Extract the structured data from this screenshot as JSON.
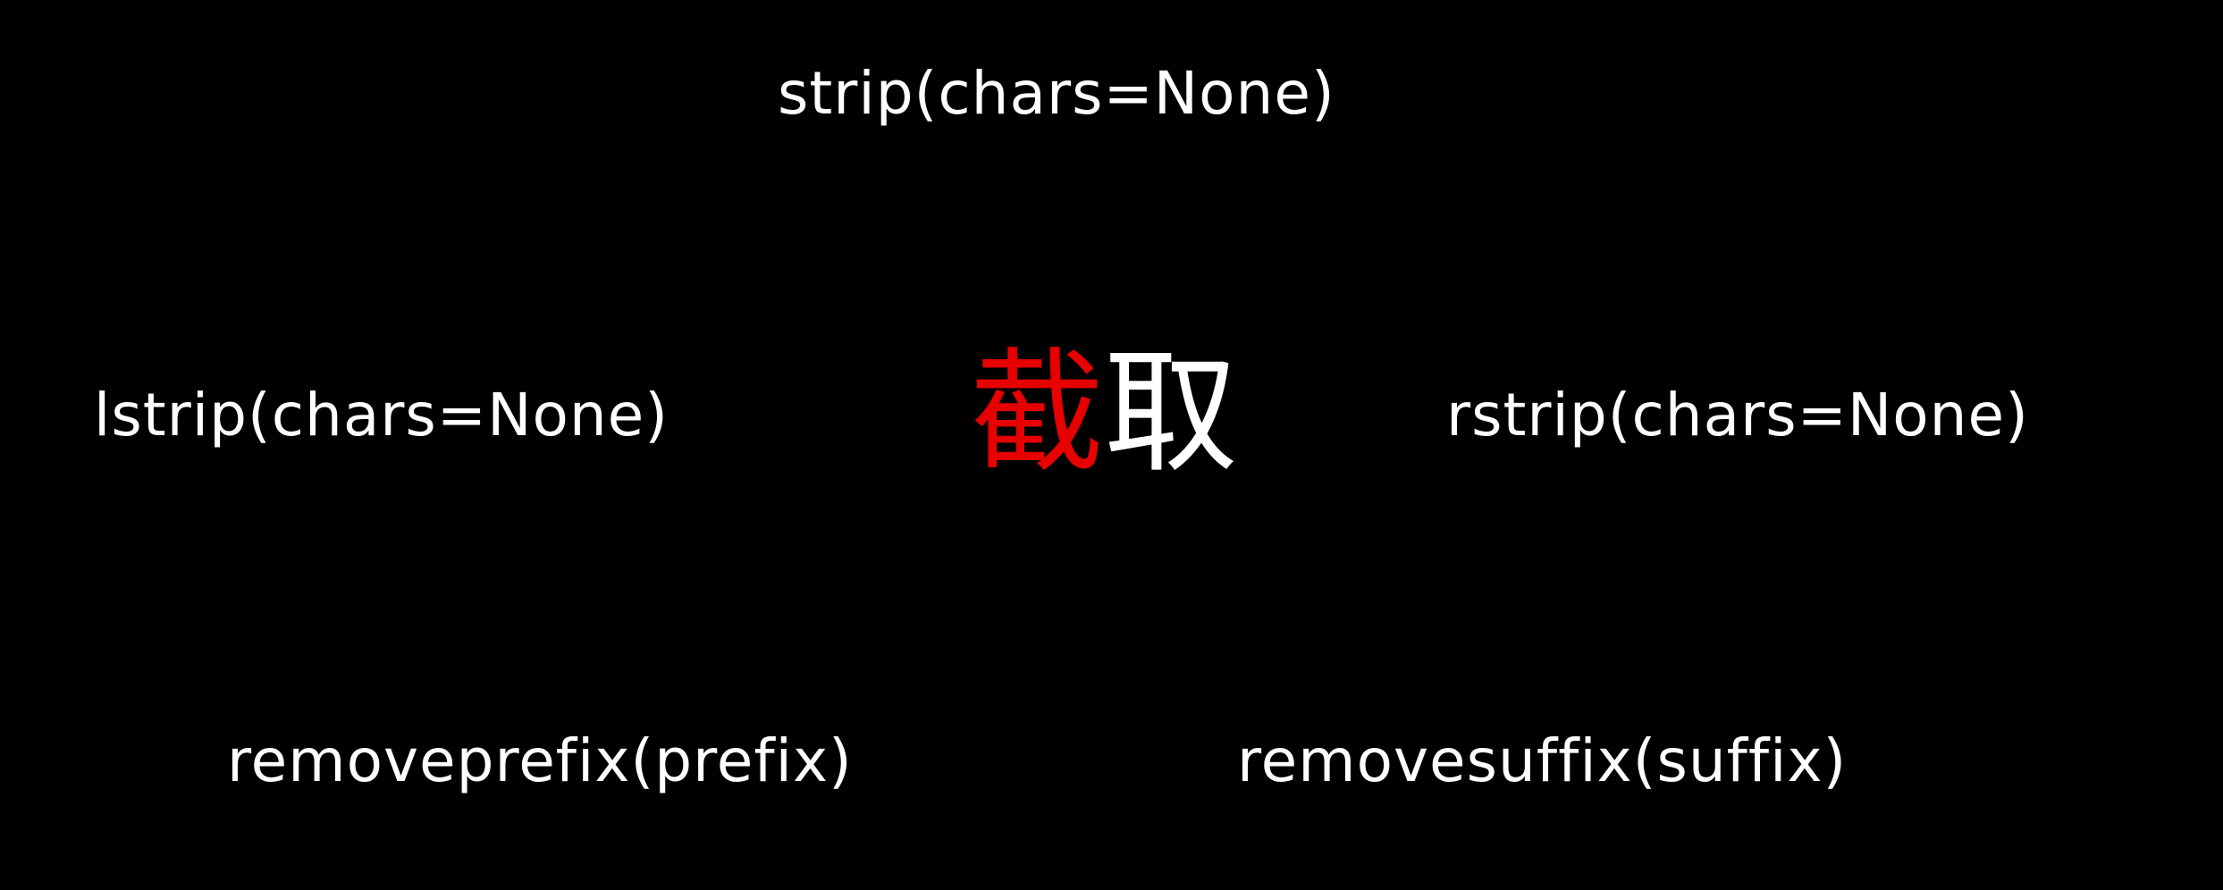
{
  "background_color": "#000000",
  "text_color": "#ffffff",
  "accent_color": "#e60000",
  "title": {
    "char_1": "截",
    "char_2": "取"
  },
  "methods": {
    "strip": "strip(chars=None)",
    "lstrip": "lstrip(chars=None)",
    "rstrip": "rstrip(chars=None)",
    "removeprefix": "removeprefix(prefix)",
    "removesuffix": "removesuffix(suffix)"
  }
}
